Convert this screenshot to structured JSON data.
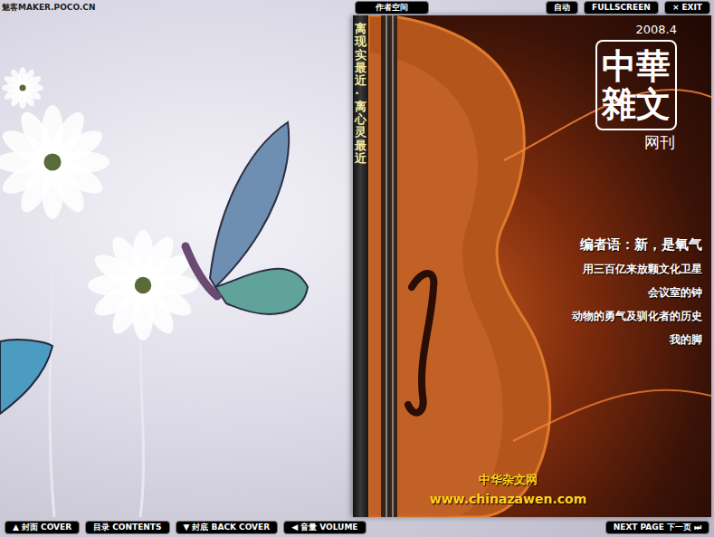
{
  "watermark": "魅客MAKER.POCO.CN",
  "top_buttons": [
    {
      "icon": "",
      "label": "作者空间"
    },
    {
      "icon": "",
      "label": "自动"
    },
    {
      "icon": "",
      "label": "FULLSCREEN"
    },
    {
      "icon": "×",
      "label": "EXIT"
    }
  ],
  "cover": {
    "spine": "离现实最近·离心灵最近",
    "date": "2008.4",
    "logo": "中華雜文",
    "logo_sub": "网刊",
    "headlines": [
      "编者语：新，是氧气",
      "用三百亿来放颗文化卫星",
      "会议室的钟",
      "动物的勇气及驯化者的历史",
      "我的脚"
    ],
    "site_name": "中华杂文网",
    "site_url": "www.chinazawen.com"
  },
  "bottom_nav": [
    {
      "icon": "▲",
      "label": "封面 COVER"
    },
    {
      "icon": "",
      "label": "目录 CONTENTS"
    },
    {
      "icon": "▼",
      "label": "封底 BACK COVER"
    },
    {
      "icon": "◀",
      "label": "音量 VOLUME"
    }
  ],
  "next_page": {
    "label": "NEXT PAGE 下一页",
    "icon": "⏭"
  }
}
